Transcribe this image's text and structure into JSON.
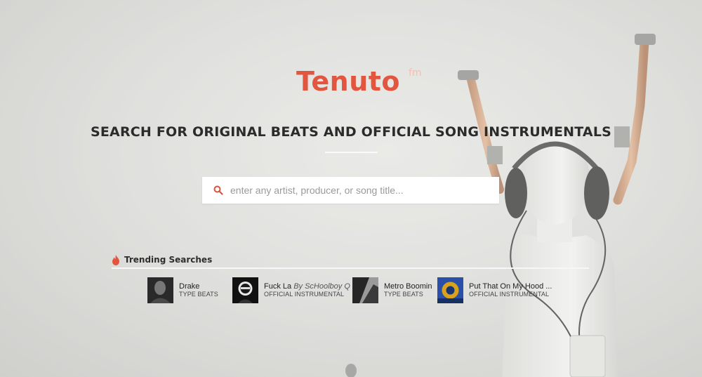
{
  "brand": {
    "name": "Tenuto",
    "suffix": "fm",
    "color": "#e2563f"
  },
  "tagline": "SEARCH FOR ORIGINAL BEATS AND OFFICIAL SONG INSTRUMENTALS",
  "search": {
    "placeholder": "enter any artist, producer, or song title...",
    "value": "",
    "icon": "search-icon",
    "icon_color": "#d9533c"
  },
  "trending": {
    "title": "Trending Searches",
    "icon": "flame-icon",
    "items": [
      {
        "name": "Drake",
        "by": "",
        "type": "TYPE BEATS",
        "thumb": "artist-photo"
      },
      {
        "name": "Fuck La",
        "by": "By ScHoolboy Q",
        "type": "OFFICIAL INSTRUMENTAL",
        "thumb": "album-art"
      },
      {
        "name": "Metro Boomin",
        "by": "",
        "type": "TYPE BEATS",
        "thumb": "artist-photo"
      },
      {
        "name": "Put That On My Hood ...",
        "by": "",
        "type": "OFFICIAL INSTRUMENTAL",
        "thumb": "album-art"
      }
    ]
  }
}
